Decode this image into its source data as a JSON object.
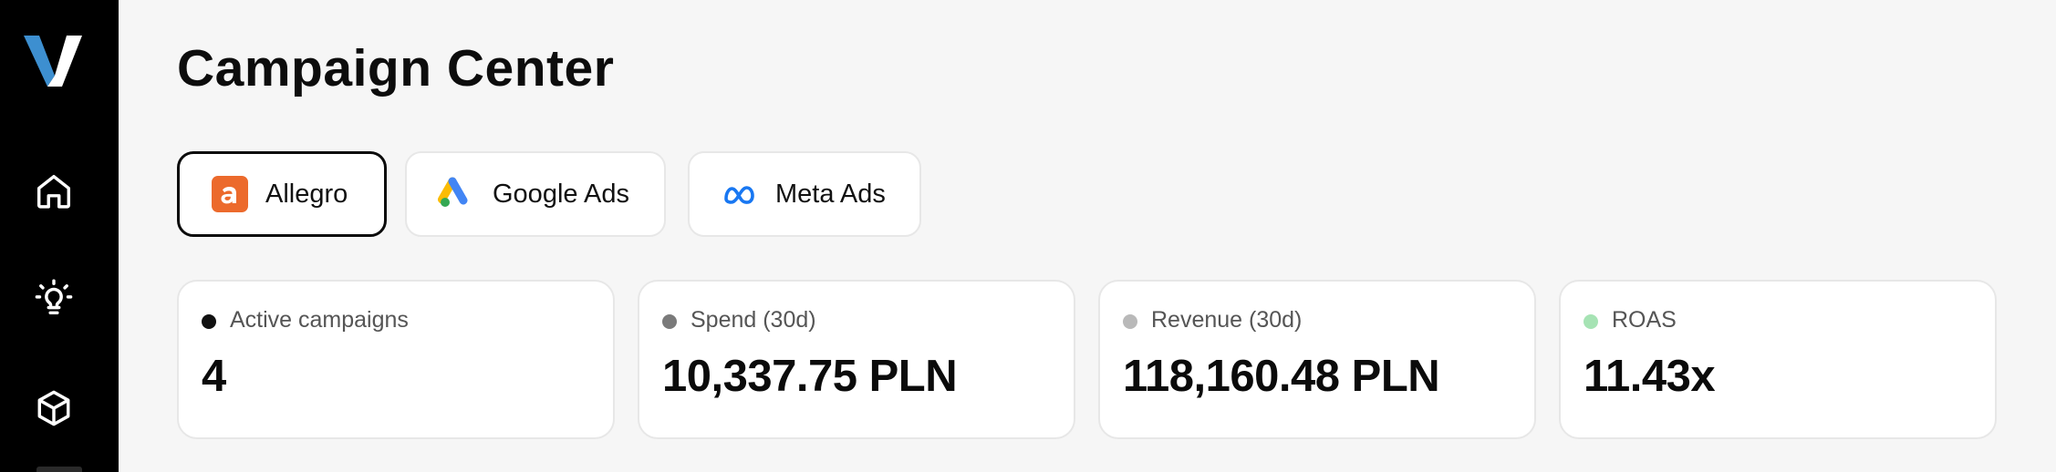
{
  "sidebar": {
    "logo_letter": "V",
    "items": [
      {
        "name": "home",
        "icon": "home-icon"
      },
      {
        "name": "ideas",
        "icon": "lightbulb-icon"
      },
      {
        "name": "products",
        "icon": "cube-icon"
      }
    ]
  },
  "page": {
    "title": "Campaign Center"
  },
  "platform_tabs": [
    {
      "label": "Allegro",
      "icon": "allegro-icon",
      "active": true
    },
    {
      "label": "Google Ads",
      "icon": "google-ads-icon",
      "active": false
    },
    {
      "label": "Meta Ads",
      "icon": "meta-icon",
      "active": false
    }
  ],
  "stats": [
    {
      "label": "Active campaigns",
      "value": "4",
      "dot_color": "#111111"
    },
    {
      "label": "Spend (30d)",
      "value": "10,337.75 PLN",
      "dot_color": "#7a7a7a"
    },
    {
      "label": "Revenue (30d)",
      "value": "118,160.48 PLN",
      "dot_color": "#b9b9b9"
    },
    {
      "label": "ROAS",
      "value": "11.43x",
      "dot_color": "#a6e3b4"
    }
  ],
  "colors": {
    "sidebar_bg": "#000000",
    "page_bg": "#f6f6f6",
    "allegro_orange": "#ec6a2c",
    "logo_blue": "#3d8fd0",
    "meta_blue": "#1877f2"
  }
}
